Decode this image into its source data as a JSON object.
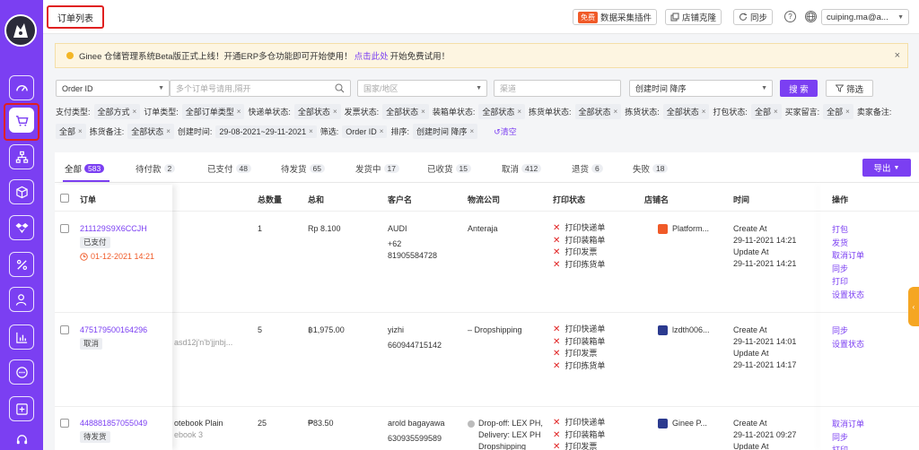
{
  "header": {
    "page_title": "订单列表",
    "plugin_badge": "免费",
    "plugin_label": "数据采集插件",
    "clone_label": "店铺克隆",
    "sync_label": "同步",
    "help_glyph": "?",
    "user_name": "cuiping.ma@a..."
  },
  "notice": {
    "text_before": "Ginee 仓储管理系统Beta版正式上线！开通ERP多仓功能即可开始使用！",
    "link": "点击此处",
    "text_after": "开始免费试用！",
    "close": "×"
  },
  "filters": {
    "field_select": "Order ID",
    "search_placeholder": "多个订单号请用,隔开",
    "country_placeholder": "国家/地区",
    "channel_placeholder": "渠道",
    "sort_select": "创建时间 降序",
    "search_button": "搜 索",
    "filter_button": "筛选",
    "row1": [
      {
        "label": "支付类型:",
        "tag": "全部方式"
      },
      {
        "label": "订单类型:",
        "tag": "全部订单类型"
      },
      {
        "label": "快递单状态:",
        "tag": "全部状态"
      },
      {
        "label": "发票状态:",
        "tag": "全部状态"
      },
      {
        "label": "装箱单状态:",
        "tag": "全部状态"
      },
      {
        "label": "拣货单状态:",
        "tag": "全部状态"
      },
      {
        "label": "拣货状态:",
        "tag": "全部状态"
      },
      {
        "label": "打包状态:",
        "tag": "全部"
      },
      {
        "label": "买家留言:",
        "tag": "全部"
      },
      {
        "label": "卖家备注:",
        "tag": ""
      }
    ],
    "row2": [
      {
        "label": "",
        "tag": "全部"
      },
      {
        "label": "拣货备注:",
        "tag": "全部状态"
      },
      {
        "label": "创建时间:",
        "tag": "29-08-2021~29-11-2021"
      },
      {
        "label": "筛选:",
        "tag": "Order ID"
      },
      {
        "label": "排序:",
        "tag": "创建时间 降序"
      }
    ],
    "clear_label": "清空",
    "tag_close": "×"
  },
  "tabs": [
    {
      "label": "全部",
      "count": "583"
    },
    {
      "label": "待付款",
      "count": "2"
    },
    {
      "label": "已支付",
      "count": "48"
    },
    {
      "label": "待发货",
      "count": "65"
    },
    {
      "label": "发货中",
      "count": "17"
    },
    {
      "label": "已收货",
      "count": "15"
    },
    {
      "label": "取消",
      "count": "412"
    },
    {
      "label": "退货",
      "count": "6"
    },
    {
      "label": "失败",
      "count": "18"
    }
  ],
  "export_label": "导出",
  "table": {
    "headers": {
      "order": "订单",
      "total_qty": "总数量",
      "total": "总和",
      "customer": "客户名",
      "logistics": "物流公司",
      "print_status": "打印状态",
      "store": "店铺名",
      "time": "时间",
      "ops": "操作"
    },
    "rows": [
      {
        "order_id": "211129S9X6CCJH",
        "status": "已支付",
        "due": "01-12-2021 14:21",
        "product": "",
        "qty": "1",
        "total": "Rp 8.100",
        "customer": "AUDI",
        "phone1": "+62",
        "phone2": "81905584728",
        "logistics": "Anteraja",
        "print": [
          "打印快递单",
          "打印装箱单",
          "打印发票",
          "打印拣货单"
        ],
        "store": "Platform...",
        "created_label": "Create At",
        "created": "29-11-2021 14:21",
        "updated_label": "Update At",
        "updated": "29-11-2021 14:21",
        "ops": [
          "打包",
          "发货",
          "取消订单",
          "同步",
          "打印",
          "设置状态"
        ]
      },
      {
        "order_id": "475179500164296",
        "status": "取消",
        "due": "",
        "product": "asd12j'n'b'jjnbj...",
        "qty": "5",
        "total": "฿1,975.00",
        "customer": "yizhi",
        "phone1": "660944715142",
        "phone2": "",
        "logistics": "– Dropshipping",
        "print": [
          "打印快递单",
          "打印装箱单",
          "打印发票",
          "打印拣货单"
        ],
        "store": "lzdth006...",
        "created_label": "Create At",
        "created": "29-11-2021 14:01",
        "updated_label": "Update At",
        "updated": "29-11-2021 14:17",
        "ops": [
          "同步",
          "设置状态"
        ]
      },
      {
        "order_id": "448881857055049",
        "status": "待发货",
        "due": "",
        "product": "otebook Plain",
        "product2": "ebook 3",
        "qty": "25",
        "total": "₱83.50",
        "customer": "arold bagayawa",
        "phone1": "630935599589",
        "phone2": "",
        "logistics": "Drop-off: LEX PH, Delivery: LEX PH Dropshipping",
        "print": [
          "打印快递单",
          "打印装箱单",
          "打印发票"
        ],
        "store": "Ginee P...",
        "created_label": "Create At",
        "created": "29-11-2021 09:27",
        "updated_label": "Update At",
        "updated": "",
        "ops": [
          "取消订单",
          "同步",
          "打印"
        ]
      }
    ]
  },
  "colors": {
    "brand": "#7b3ff2",
    "error_red": "#e02020",
    "warning": "#f3b626",
    "overdue": "#f05a28"
  }
}
